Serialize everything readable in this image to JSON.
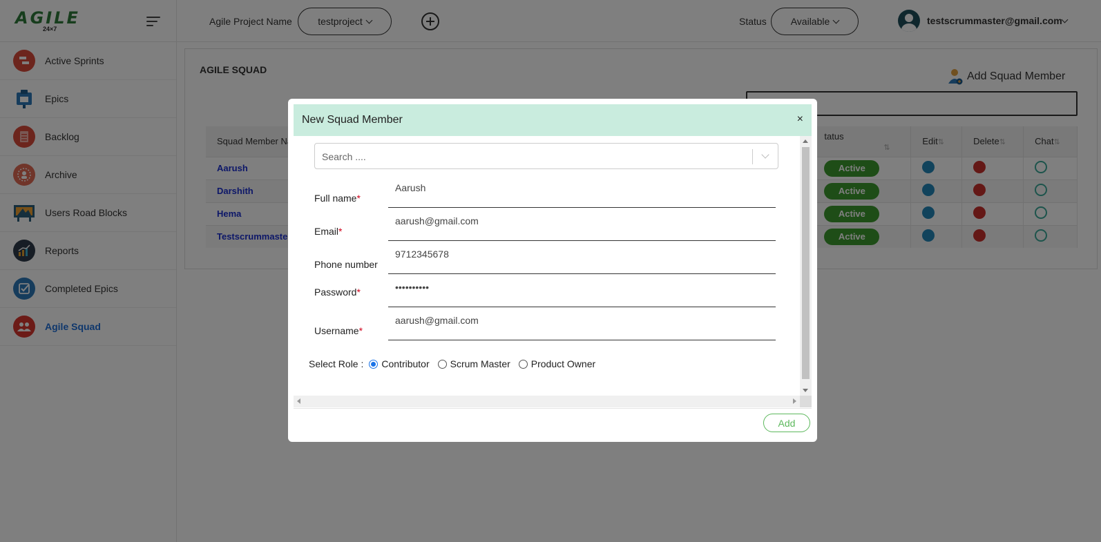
{
  "brand": {
    "logo_text": "AGILE",
    "logo_sub": "24×7"
  },
  "sidebar": {
    "items": [
      {
        "label": "Active Sprints",
        "color": "#d94b3b"
      },
      {
        "label": "Epics",
        "color": "#2c79b8"
      },
      {
        "label": "Backlog",
        "color": "#d94b3b"
      },
      {
        "label": "Archive",
        "color": "#e06a54"
      },
      {
        "label": "Users Road Blocks",
        "color": "#2a5f7a"
      },
      {
        "label": "Reports",
        "color": "#2e3b4a"
      },
      {
        "label": "Completed Epics",
        "color": "#2c79b8"
      },
      {
        "label": "Agile Squad",
        "color": "#d9362f"
      }
    ],
    "active_index": 7
  },
  "header": {
    "project_label": "Agile Project Name",
    "project_value": "testproject",
    "status_label": "Status",
    "status_value": "Available",
    "user_email": "testscrummaster@gmail.com"
  },
  "main": {
    "title": "AGILE SQUAD",
    "add_member_label": "Add Squad Member",
    "columns": [
      "Squad Member Na",
      "tatus",
      "Edit",
      "Delete",
      "Chat"
    ],
    "rows": [
      {
        "name": "Aarush",
        "status": "Active"
      },
      {
        "name": "Darshith",
        "status": "Active"
      },
      {
        "name": "Hema",
        "status": "Active"
      },
      {
        "name": "Testscrummaster",
        "status": "Active"
      }
    ]
  },
  "modal": {
    "title": "New Squad Member",
    "close_glyph": "×",
    "search_placeholder": "Search ....",
    "fields": {
      "full_name": {
        "label": "Full name",
        "value": "Aarush",
        "required": true
      },
      "email": {
        "label": "Email",
        "value": "aarush@gmail.com",
        "required": true
      },
      "phone": {
        "label": "Phone number",
        "value": "9712345678",
        "required": false
      },
      "password": {
        "label": "Password",
        "value": "••••••••••",
        "required": true
      },
      "username": {
        "label": "Username",
        "value": "aarush@gmail.com",
        "required": true
      }
    },
    "role_label": "Select Role :",
    "roles": [
      "Contributor",
      "Scrum Master",
      "Product Owner"
    ],
    "selected_role": "Contributor",
    "add_button": "Add"
  },
  "colors": {
    "modal_header": "#c9ecde",
    "active_badge": "#3d9a2e",
    "add_button": "#5cb85c",
    "link": "#1a2fd1"
  }
}
